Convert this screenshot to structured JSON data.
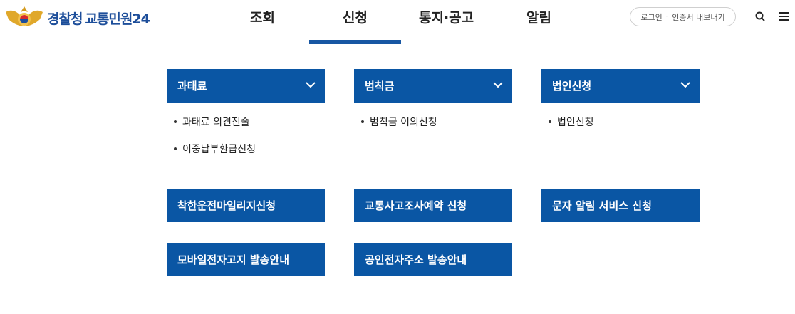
{
  "header": {
    "logo_org": "경찰청",
    "logo_service": "교통민원24",
    "nav": [
      "조회",
      "신청",
      "통지·공고",
      "알림"
    ],
    "active_nav": "신청",
    "login_label": "로그인",
    "cert_label": "인증서 내보내기",
    "icons": [
      "search-icon",
      "menu-icon"
    ]
  },
  "sections": [
    {
      "title": "과태료",
      "items": [
        "과태료 의견진술",
        "이중납부환급신청"
      ]
    },
    {
      "title": "범칙금",
      "items": [
        "범칙금 이의신청"
      ]
    },
    {
      "title": "법인신청",
      "items": [
        "법인신청"
      ]
    }
  ],
  "links": [
    "착한운전마일리지신청",
    "교통사고조사예약 신청",
    "문자 알림 서비스 신청",
    "모바일전자고지 발송안내",
    "공인전자주소 발송안내"
  ],
  "colors": {
    "primary": "#0a56a4",
    "logo": "#1d4e9a",
    "active_bar": "#1857a3"
  }
}
